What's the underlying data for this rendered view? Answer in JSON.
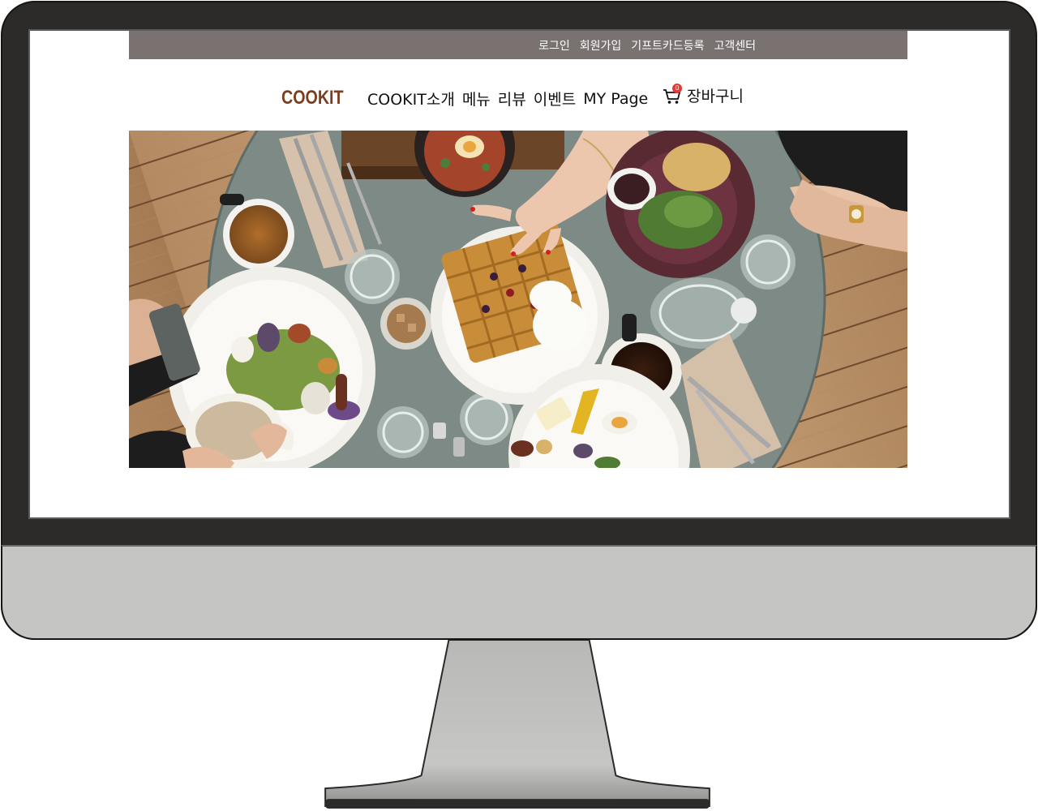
{
  "topbar": {
    "links": [
      "로그인",
      "회원가입",
      "기프트카드등록",
      "고객센터"
    ]
  },
  "header": {
    "logo": "COOKIT",
    "nav": [
      "COOKIT소개",
      "메뉴",
      "리뷰",
      "이벤트",
      "MY Page"
    ],
    "cart": {
      "label": "장바구니",
      "count": "0"
    }
  },
  "colors": {
    "topbar_bg": "#797270",
    "logo": "#7a3f22",
    "badge": "#e53935"
  },
  "icons": {
    "cart": "shopping-cart-icon"
  }
}
